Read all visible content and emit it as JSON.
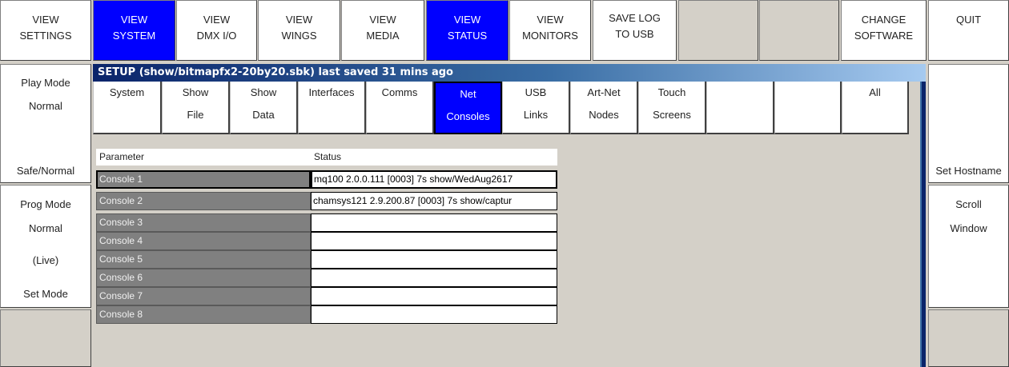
{
  "toolbar": {
    "view_settings": [
      "VIEW",
      "SETTINGS"
    ],
    "view_system": [
      "VIEW",
      "SYSTEM"
    ],
    "view_dmx": [
      "VIEW",
      "DMX I/O"
    ],
    "view_wings": [
      "VIEW",
      "WINGS"
    ],
    "view_media": [
      "VIEW",
      "MEDIA"
    ],
    "view_status": [
      "VIEW",
      "STATUS"
    ],
    "view_monitors": [
      "VIEW",
      "MONITORS"
    ],
    "save_log": [
      "SAVE LOG",
      "TO USB"
    ],
    "change_software": [
      "CHANGE",
      "SOFTWARE"
    ],
    "quit": "QUIT"
  },
  "left_panel": {
    "play_mode_label": "Play Mode",
    "play_mode_value": "Normal",
    "safe_normal": "Safe/Normal",
    "prog_mode_label": "Prog Mode",
    "prog_mode_value": "Normal",
    "prog_mode_live": "(Live)",
    "set_mode": "Set Mode"
  },
  "right_panel": {
    "set_hostname": "Set Hostname",
    "scroll": "Scroll",
    "window": "Window"
  },
  "setup": {
    "title": "SETUP (show/bitmapfx2-20by20.sbk) last saved 31 mins ago",
    "tabs": [
      {
        "l1": "System",
        "l2": ""
      },
      {
        "l1": "Show",
        "l2": "File"
      },
      {
        "l1": "Show",
        "l2": "Data"
      },
      {
        "l1": "Interfaces",
        "l2": ""
      },
      {
        "l1": "Comms",
        "l2": ""
      },
      {
        "l1": "Net",
        "l2": "Consoles"
      },
      {
        "l1": "USB",
        "l2": "Links"
      },
      {
        "l1": "Art-Net",
        "l2": "Nodes"
      },
      {
        "l1": "Touch",
        "l2": "Screens"
      },
      {
        "l1": "",
        "l2": ""
      },
      {
        "l1": "",
        "l2": ""
      },
      {
        "l1": "All",
        "l2": ""
      }
    ],
    "table": {
      "col_parameter": "Parameter",
      "col_status": "Status",
      "rows": [
        {
          "param": "Console 1",
          "status": "mq100 2.0.0.111 [0003] 7s show/WedAug2617"
        },
        {
          "param": "Console 2",
          "status": "chamsys121 2.9.200.87 [0003] 7s show/captur"
        },
        {
          "param": "Console 3",
          "status": ""
        },
        {
          "param": "Console 4",
          "status": ""
        },
        {
          "param": "Console 5",
          "status": ""
        },
        {
          "param": "Console 6",
          "status": ""
        },
        {
          "param": "Console 7",
          "status": ""
        },
        {
          "param": "Console 8",
          "status": ""
        }
      ]
    }
  },
  "colors": {
    "active_blue": "#0000ff",
    "title_bar": "#0a246a",
    "background": "#d4d0c8"
  }
}
